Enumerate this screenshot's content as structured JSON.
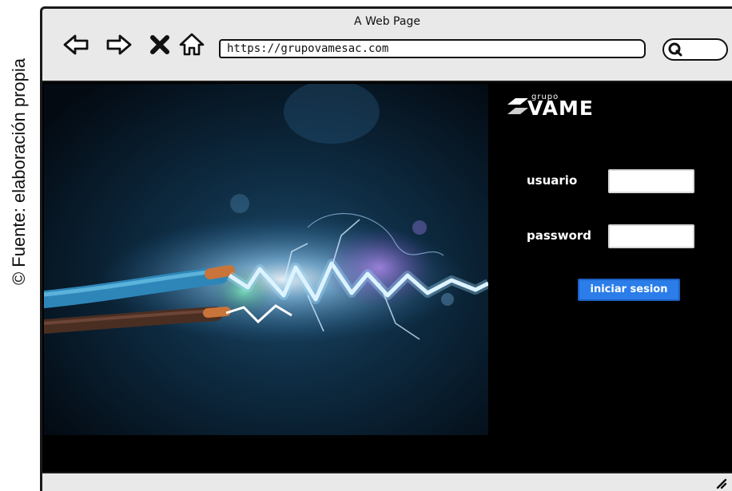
{
  "caption": "© Fuente: elaboración propia",
  "window": {
    "title": "A Web Page",
    "url": "https://grupovamesac.com"
  },
  "nav": {
    "back_icon": "arrow-left-icon",
    "forward_icon": "arrow-right-icon",
    "stop_icon": "close-icon",
    "home_icon": "home-icon",
    "search_icon": "search-icon"
  },
  "brand": {
    "small": "grupo",
    "name": "VAME"
  },
  "login": {
    "user_label": "usuario",
    "user_value": "",
    "password_label": "password",
    "password_value": "",
    "submit_label": "iniciar sesion"
  },
  "colors": {
    "background": "#000000",
    "chrome": "#e9e9e9",
    "button": "#2b7de9"
  }
}
